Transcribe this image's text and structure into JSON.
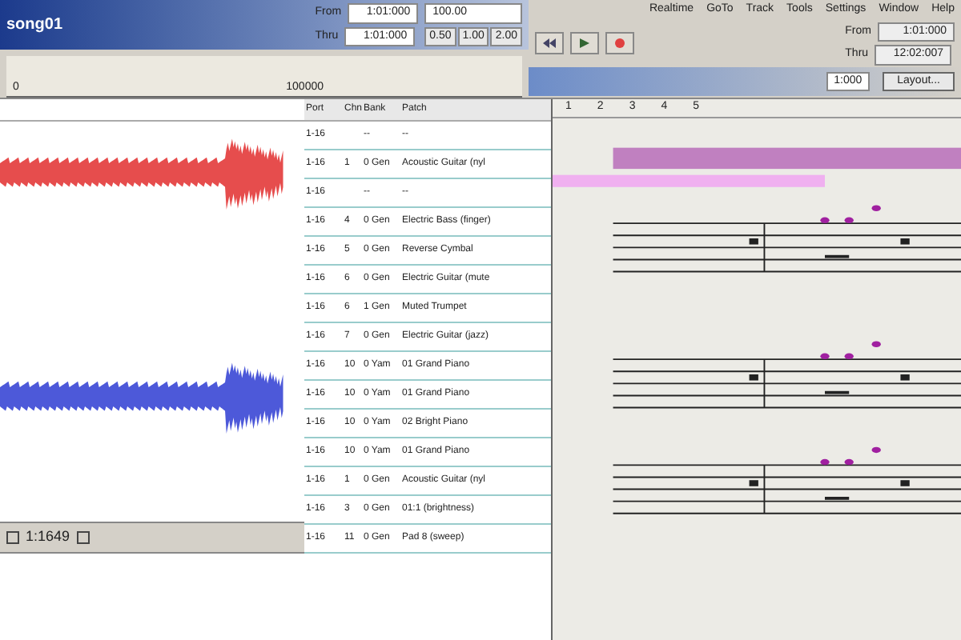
{
  "window": {
    "title": "song01"
  },
  "menu": [
    "Realtime",
    "GoTo",
    "Track",
    "Tools",
    "Settings",
    "Window",
    "Help"
  ],
  "toolbar": {
    "from_label": "From",
    "from_value": "1:01:000",
    "thru_label": "Thru",
    "thru_value": "1:01:000",
    "tempo": "100.00",
    "ratios": [
      "0.50",
      "1.00",
      "2.00"
    ],
    "ruler_start": "0",
    "ruler_end": "100000"
  },
  "transport": {
    "from_label": "From",
    "from_value": "1:01:000",
    "thru_label": "Thru",
    "thru_value": "12:02:007"
  },
  "staff_toolbar": {
    "layout_button": "Layout...",
    "position": "1:000",
    "measures": [
      "1",
      "2",
      "3",
      "4",
      "5"
    ]
  },
  "track_table": {
    "columns": [
      "Port",
      "Chn",
      "Bank",
      "Patch"
    ],
    "rows": [
      {
        "port": "1-16",
        "chn": "",
        "bank": "--",
        "patch": "--",
        "selected": false
      },
      {
        "port": "1-16",
        "chn": "1",
        "bank": "0 Gen",
        "patch": "Acoustic Guitar (nyl",
        "selected": false
      },
      {
        "port": "1-16",
        "chn": "",
        "bank": "--",
        "patch": "--",
        "selected": false
      },
      {
        "port": "1-16",
        "chn": "4",
        "bank": "0 Gen",
        "patch": "Electric Bass (finger)",
        "selected": false
      },
      {
        "port": "1-16",
        "chn": "5",
        "bank": "0 Gen",
        "patch": "Reverse Cymbal",
        "selected": false
      },
      {
        "port": "1-16",
        "chn": "6",
        "bank": "0 Gen",
        "patch": "Electric Guitar (mute",
        "selected": false
      },
      {
        "port": "1-16",
        "chn": "6",
        "bank": "1 Gen",
        "patch": "Muted Trumpet",
        "selected": false
      },
      {
        "port": "1-16",
        "chn": "7",
        "bank": "0 Gen",
        "patch": "Electric Guitar (jazz)",
        "selected": false
      },
      {
        "port": "1-16",
        "chn": "10",
        "bank": "0 Yam",
        "patch": "01 Grand Piano",
        "selected": false
      },
      {
        "port": "1-16",
        "chn": "10",
        "bank": "0 Yam",
        "patch": "01 Grand Piano",
        "selected": false
      },
      {
        "port": "1-16",
        "chn": "10",
        "bank": "0 Yam",
        "patch": "02 Bright Piano",
        "selected": false
      },
      {
        "port": "1-16",
        "chn": "10",
        "bank": "0 Yam",
        "patch": "01 Grand Piano",
        "selected": false
      },
      {
        "port": "1-16",
        "chn": "1",
        "bank": "0 Gen",
        "patch": "Acoustic Guitar (nyl",
        "selected": false
      },
      {
        "port": "1-16",
        "chn": "3",
        "bank": "0 Gen",
        "patch": "01:1 (brightness)",
        "selected": false
      },
      {
        "port": "1-16",
        "chn": "11",
        "bank": "0 Gen",
        "patch": "Pad 8 (sweep)",
        "selected": false
      }
    ]
  },
  "counter": "1:1649"
}
